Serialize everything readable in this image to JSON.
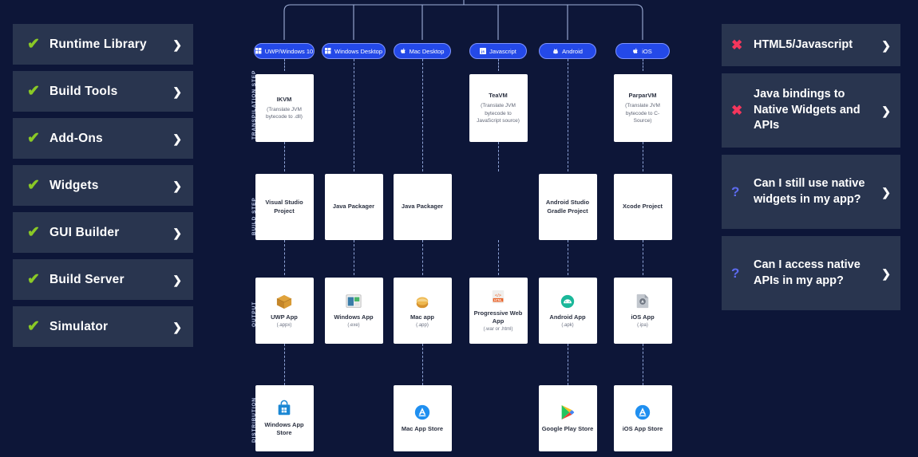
{
  "left_rail": {
    "items": [
      {
        "icon": "check-icon",
        "label": "Runtime Library",
        "chevron": "❯"
      },
      {
        "icon": "check-icon",
        "label": "Build Tools",
        "chevron": "❯"
      },
      {
        "icon": "check-icon",
        "label": "Add-Ons",
        "chevron": "❯"
      },
      {
        "icon": "check-icon",
        "label": "Widgets",
        "chevron": "❯"
      },
      {
        "icon": "check-icon",
        "label": "GUI Builder",
        "chevron": "❯"
      },
      {
        "icon": "check-icon",
        "label": "Build Server",
        "chevron": "❯"
      },
      {
        "icon": "check-icon",
        "label": "Simulator",
        "chevron": "❯"
      }
    ],
    "check_glyph": "✔",
    "check_color": "#8ac926"
  },
  "right_rail": {
    "items": [
      {
        "icon": "cross-icon",
        "glyph": "✖",
        "label": "HTML5/Javascript",
        "chevron": "❯",
        "lines": 1
      },
      {
        "icon": "cross-icon",
        "glyph": "✖",
        "label": "Java bindings to Native Widgets and APIs",
        "chevron": "❯",
        "lines": 3
      },
      {
        "icon": "question-icon",
        "glyph": "?",
        "label": "Can I still use native widgets in my app?",
        "chevron": "❯",
        "lines": 3
      },
      {
        "icon": "question-icon",
        "glyph": "?",
        "label": "Can I access native APIs in my app?",
        "chevron": "❯",
        "lines": 3
      }
    ],
    "cross_color": "#f5365c",
    "question_color": "#5d6bf0"
  },
  "diagram": {
    "row_labels": [
      "TRANSPILATION STEP",
      "BUILD STEP",
      "OUTPUT",
      "DISTRIBUTION"
    ],
    "platforms": [
      {
        "label": "UWP/Windows 10",
        "icon": "windows-icon"
      },
      {
        "label": "Windows Desktop",
        "icon": "windows-icon"
      },
      {
        "label": "Mac Desktop",
        "icon": "apple-icon"
      },
      {
        "label": "Javascript",
        "icon": "javascript-icon"
      },
      {
        "label": "Android",
        "icon": "android-icon"
      },
      {
        "label": "iOS",
        "icon": "apple-icon"
      }
    ],
    "transpilation": [
      {
        "title": "IKVM",
        "subtitle": "(Translate JVM bytecode to .dll)"
      },
      {
        "title": "TeaVM",
        "subtitle": "(Translate JVM bytecode to JavaScript source)"
      },
      {
        "title": "ParparVM",
        "subtitle": "(Translate JVM bytecode to C-Source)"
      }
    ],
    "build": [
      {
        "title": "Visual Studio Project"
      },
      {
        "title": "Java Packager"
      },
      {
        "title": "Java Packager"
      },
      {
        "title": "Android Studio Gradle Project"
      },
      {
        "title": "Xcode Project"
      }
    ],
    "output": [
      {
        "title": "UWP App",
        "ext": "(.appx)",
        "icon": "package-box-icon"
      },
      {
        "title": "Windows App",
        "ext": "(.exe)",
        "icon": "windows-app-icon"
      },
      {
        "title": "Mac app",
        "ext": "(.app)",
        "icon": "mac-app-icon"
      },
      {
        "title": "Progressive Web App",
        "ext": "(.war or .html)",
        "icon": "html5-file-icon"
      },
      {
        "title": "Android App",
        "ext": "(.apk)",
        "icon": "android-app-icon"
      },
      {
        "title": "iOS App",
        "ext": "(.ipa)",
        "icon": "ios-file-icon"
      }
    ],
    "distribution": [
      {
        "title": "Windows App Store",
        "icon": "windows-store-icon"
      },
      {
        "title": "Mac App Store",
        "icon": "app-store-icon"
      },
      {
        "title": "Google Play Store",
        "icon": "google-play-icon"
      },
      {
        "title": "iOS App Store",
        "icon": "app-store-icon"
      }
    ]
  }
}
